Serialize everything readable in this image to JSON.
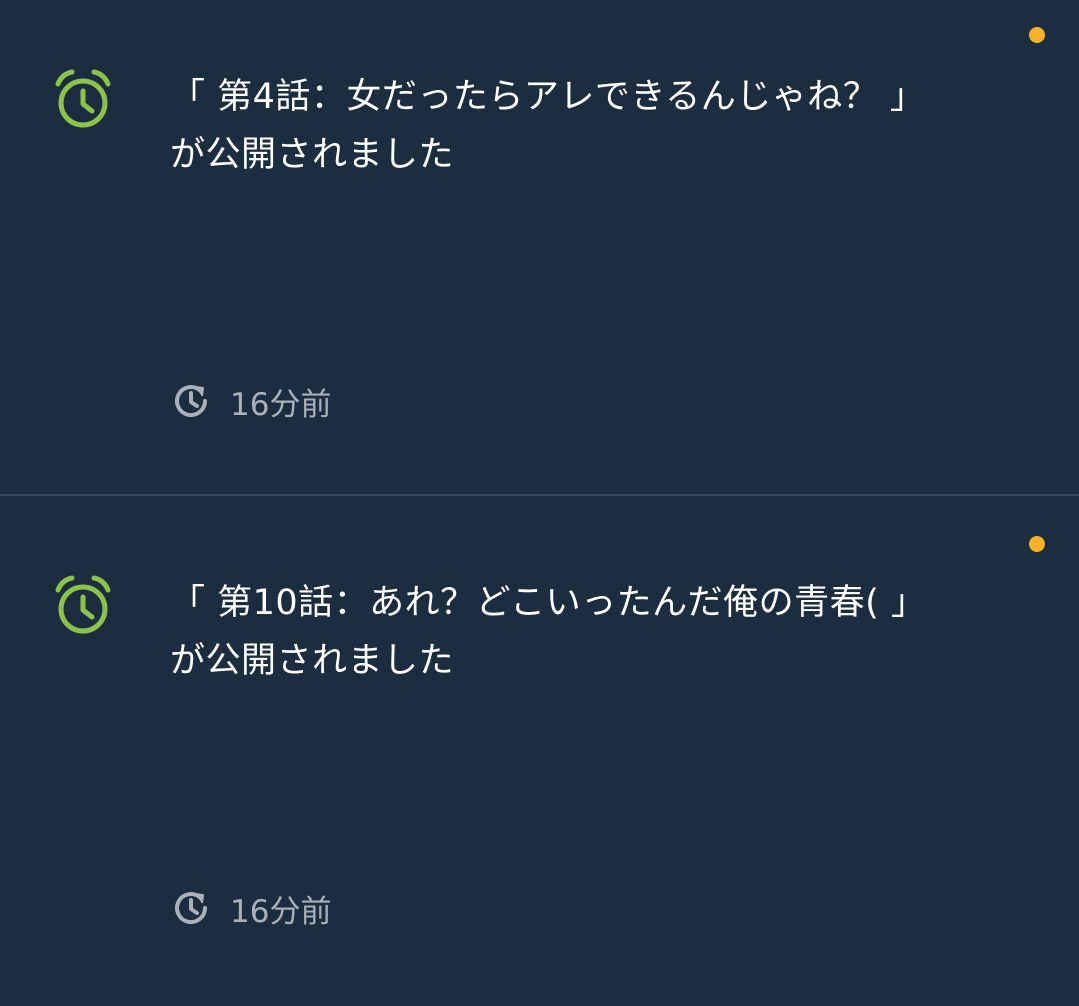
{
  "colors": {
    "background": "#1c2d3f",
    "divider": "#3a4a5a",
    "alarm_icon": "#8bc34a",
    "unread_dot": "#f6b327",
    "text": "#ffffff",
    "time_text": "#a9b0b8"
  },
  "notifications": [
    {
      "icon": "alarm-clock-icon",
      "title_line": "「 第4話：女だったらアレできるんじゃね？ 」",
      "status_line": "が公開されました",
      "time_icon": "history-clock-icon",
      "time": "16分前",
      "unread": true
    },
    {
      "icon": "alarm-clock-icon",
      "title_line": "「 第10話：あれ？どこいったんだ俺の青春( 」",
      "status_line": "が公開されました",
      "time_icon": "history-clock-icon",
      "time": "16分前",
      "unread": true
    }
  ]
}
